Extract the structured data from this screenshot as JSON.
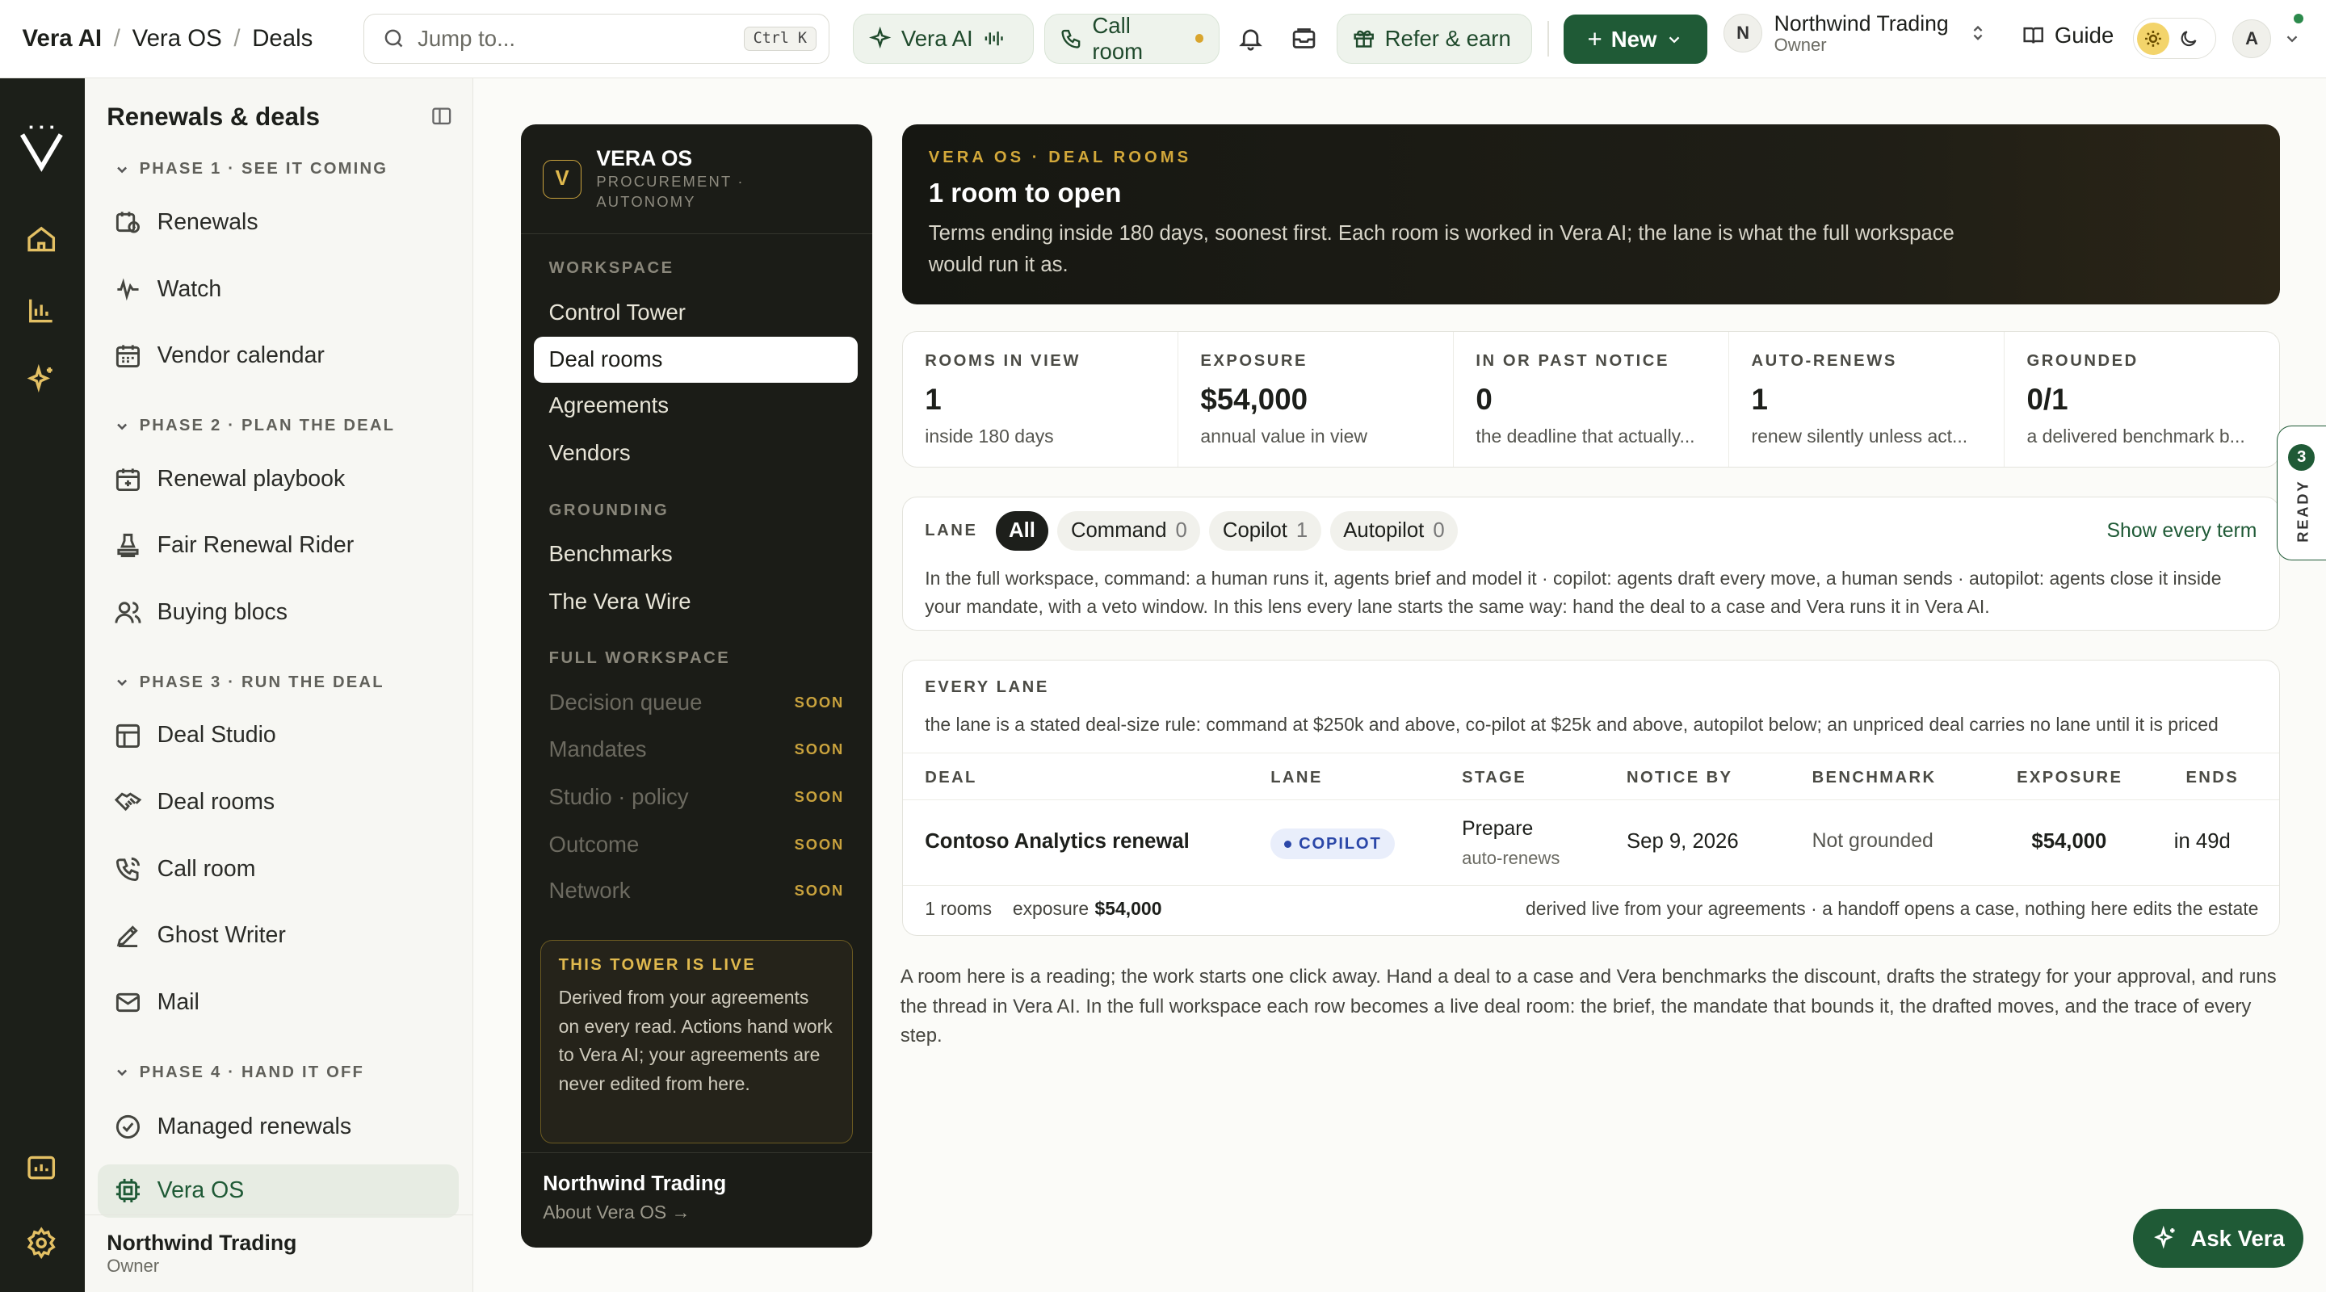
{
  "breadcrumb": {
    "brand": "Vera AI",
    "section": "Vera OS",
    "page": "Deals"
  },
  "search": {
    "placeholder": "Jump to...",
    "shortcut": "Ctrl K"
  },
  "topbar": {
    "vera_ai": "Vera AI",
    "call_room": "Call room",
    "refer": "Refer & earn",
    "new": "New",
    "account_initial": "N",
    "account_name": "Northwind Trading",
    "account_role": "Owner",
    "guide": "Guide",
    "user_initial": "A",
    "accent": "#1f5a36",
    "status_dot": "#2c8a4c"
  },
  "sidebar": {
    "title": "Renewals & deals",
    "phases": [
      {
        "label": "PHASE 1 · SEE IT COMING",
        "items": [
          "Renewals",
          "Watch",
          "Vendor calendar"
        ]
      },
      {
        "label": "PHASE 2 · PLAN THE DEAL",
        "items": [
          "Renewal playbook",
          "Fair Renewal Rider",
          "Buying blocs"
        ]
      },
      {
        "label": "PHASE 3 · RUN THE DEAL",
        "items": [
          "Deal Studio",
          "Deal rooms",
          "Call room",
          "Ghost Writer",
          "Mail"
        ]
      },
      {
        "label": "PHASE 4 · HAND IT OFF",
        "items": [
          "Managed renewals",
          "Vera OS"
        ]
      }
    ],
    "footer_name": "Northwind Trading",
    "footer_role": "Owner"
  },
  "veraos": {
    "logo": "V",
    "title": "VERA OS",
    "subtitle": "PROCUREMENT · AUTONOMY",
    "sections": {
      "workspace": "WORKSPACE",
      "grounding": "GROUNDING",
      "full": "FULL WORKSPACE"
    },
    "workspace": [
      "Control Tower",
      "Deal rooms",
      "Agreements",
      "Vendors"
    ],
    "grounding": [
      "Benchmarks",
      "The Vera Wire"
    ],
    "full": [
      "Decision queue",
      "Mandates",
      "Studio · policy",
      "Outcome",
      "Network"
    ],
    "soon": "SOON",
    "live_title": "THIS TOWER IS LIVE",
    "live_text": "Derived from your agreements on every read. Actions hand work to Vera AI; your agreements are never edited from here.",
    "footer_name": "Northwind Trading",
    "footer_link": "About Vera OS →"
  },
  "hero": {
    "kicker": "VERA OS · DEAL ROOMS",
    "title": "1 room to open",
    "text": "Terms ending inside 180 days, soonest first. Each room is worked in Vera AI; the lane is what the full workspace would run it as."
  },
  "stats": [
    {
      "label": "ROOMS IN VIEW",
      "value": "1",
      "sub": "inside 180 days"
    },
    {
      "label": "EXPOSURE",
      "value": "$54,000",
      "sub": "annual value in view"
    },
    {
      "label": "IN OR PAST NOTICE",
      "value": "0",
      "sub": "the deadline that actually..."
    },
    {
      "label": "AUTO-RENEWS",
      "value": "1",
      "sub": "renew silently unless act..."
    },
    {
      "label": "GROUNDED",
      "value": "0/1",
      "sub": "a delivered benchmark b..."
    }
  ],
  "lane": {
    "label": "LANE",
    "chips": [
      {
        "name": "All",
        "count": ""
      },
      {
        "name": "Command",
        "count": "0"
      },
      {
        "name": "Copilot",
        "count": "1"
      },
      {
        "name": "Autopilot",
        "count": "0"
      }
    ],
    "show_all": "Show every term",
    "text": "In the full workspace, command: a human runs it, agents brief and model it · copilot: agents draft every move, a human sends · autopilot: agents close it inside your mandate, with a veto window. In this lens every lane starts the same way: hand the deal to a case and Vera runs it in Vera AI."
  },
  "table": {
    "kicker": "EVERY LANE",
    "desc": "the lane is a stated deal-size rule: command at $250k and above, co-pilot at $25k and above, autopilot below; an unpriced deal carries no lane until it is priced",
    "headers": {
      "deal": "DEAL",
      "lane": "LANE",
      "stage": "STAGE",
      "notice": "NOTICE BY",
      "bench": "BENCHMARK",
      "exposure": "EXPOSURE",
      "ends": "ENDS"
    },
    "row": {
      "deal": "Contoso Analytics renewal",
      "lane": "COPILOT",
      "stage": "Prepare",
      "stage_sub": "auto-renews",
      "notice": "Sep 9, 2026",
      "bench": "Not grounded",
      "exposure": "$54,000",
      "ends": "in 49d"
    },
    "footer_count": "1 rooms",
    "footer_exposure_label": "exposure",
    "footer_exposure": "$54,000",
    "footer_note": "derived live from your agreements · a handoff opens a case, nothing here edits the estate"
  },
  "note": "A room here is a reading; the work starts one click away. Hand a deal to a case and Vera benchmarks the discount, drafts the strategy for your approval, and runs the thread in Vera AI. In the full workspace each row becomes a live deal room: the brief, the mandate that bounds it, the drafted moves, and the trace of every step.",
  "ready": {
    "count": "3",
    "label": "READY"
  },
  "ask": "Ask Vera"
}
